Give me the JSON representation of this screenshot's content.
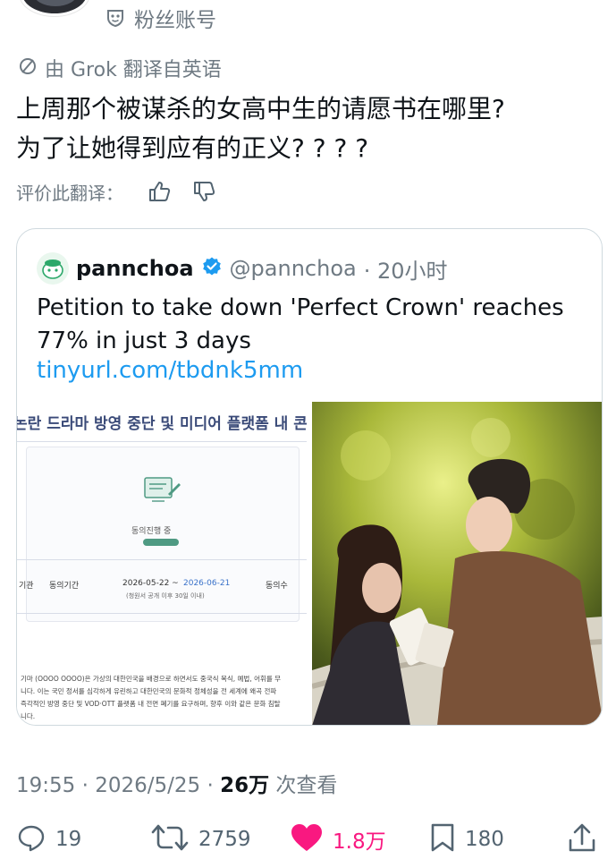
{
  "header": {
    "fan_label": "粉丝账号"
  },
  "translation": {
    "label": "由 Grok 翻译自英语",
    "rate_label": "评价此翻译："
  },
  "tweet": {
    "lines": [
      "上周那个被谋杀的女高中生的请愿书在哪里?",
      "为了让她得到应有的正义? ? ? ?"
    ]
  },
  "quote": {
    "name": "pannchoa",
    "handle": "@pannchoa",
    "time": "· 20小时",
    "text": "Petition to take down 'Perfect Crown' reaches 77% in just 3 days",
    "link": "tinyurl.com/tbdnk5mm",
    "doc": {
      "title": "논란 드라마 방영 중단 및 미디어 플랫폼 내 콘텐",
      "status": "동의진행 중",
      "col1": "기관",
      "col2": "동의기간",
      "date_range_start": "2026-05-22 ~",
      "date_range_end": "2026-06-21",
      "date_note": "(청원서 공개 이후 30일 이내)",
      "col3": "동의수",
      "para": [
        "기마 (OOOO OOOO)은 가상의 대한민국을 배경으로 하면서도 중국식 복식, 예법, 어휘를 무",
        "니다. 이는 국민 정서를 심각하게 유린하고 대한민국의 문화적 정체성을 전 세계에 왜곡 전파",
        "즉각적인 방영 중단 및 VOD·OTT 플랫폼 내 전면 폐기를 요구하며, 향후 이와 같은 문화 침탈",
        "니다."
      ]
    }
  },
  "footer": {
    "time": "19:55 · 2026/5/25 · ",
    "views_count": "26万",
    "views_label": " 次查看"
  },
  "actions": {
    "replies": "19",
    "retweets": "2759",
    "likes": "1.8万",
    "bookmarks": "180"
  },
  "colors": {
    "accent": "#1d9bf0",
    "like": "#f91880",
    "muted": "#6f7a83",
    "verified": "#1d9bf0"
  },
  "icons": [
    "mask-icon",
    "translate-icon",
    "thumbs-up-icon",
    "thumbs-down-icon",
    "verified-badge-icon",
    "reply-icon",
    "retweet-icon",
    "heart-icon",
    "bookmark-icon",
    "share-icon"
  ]
}
